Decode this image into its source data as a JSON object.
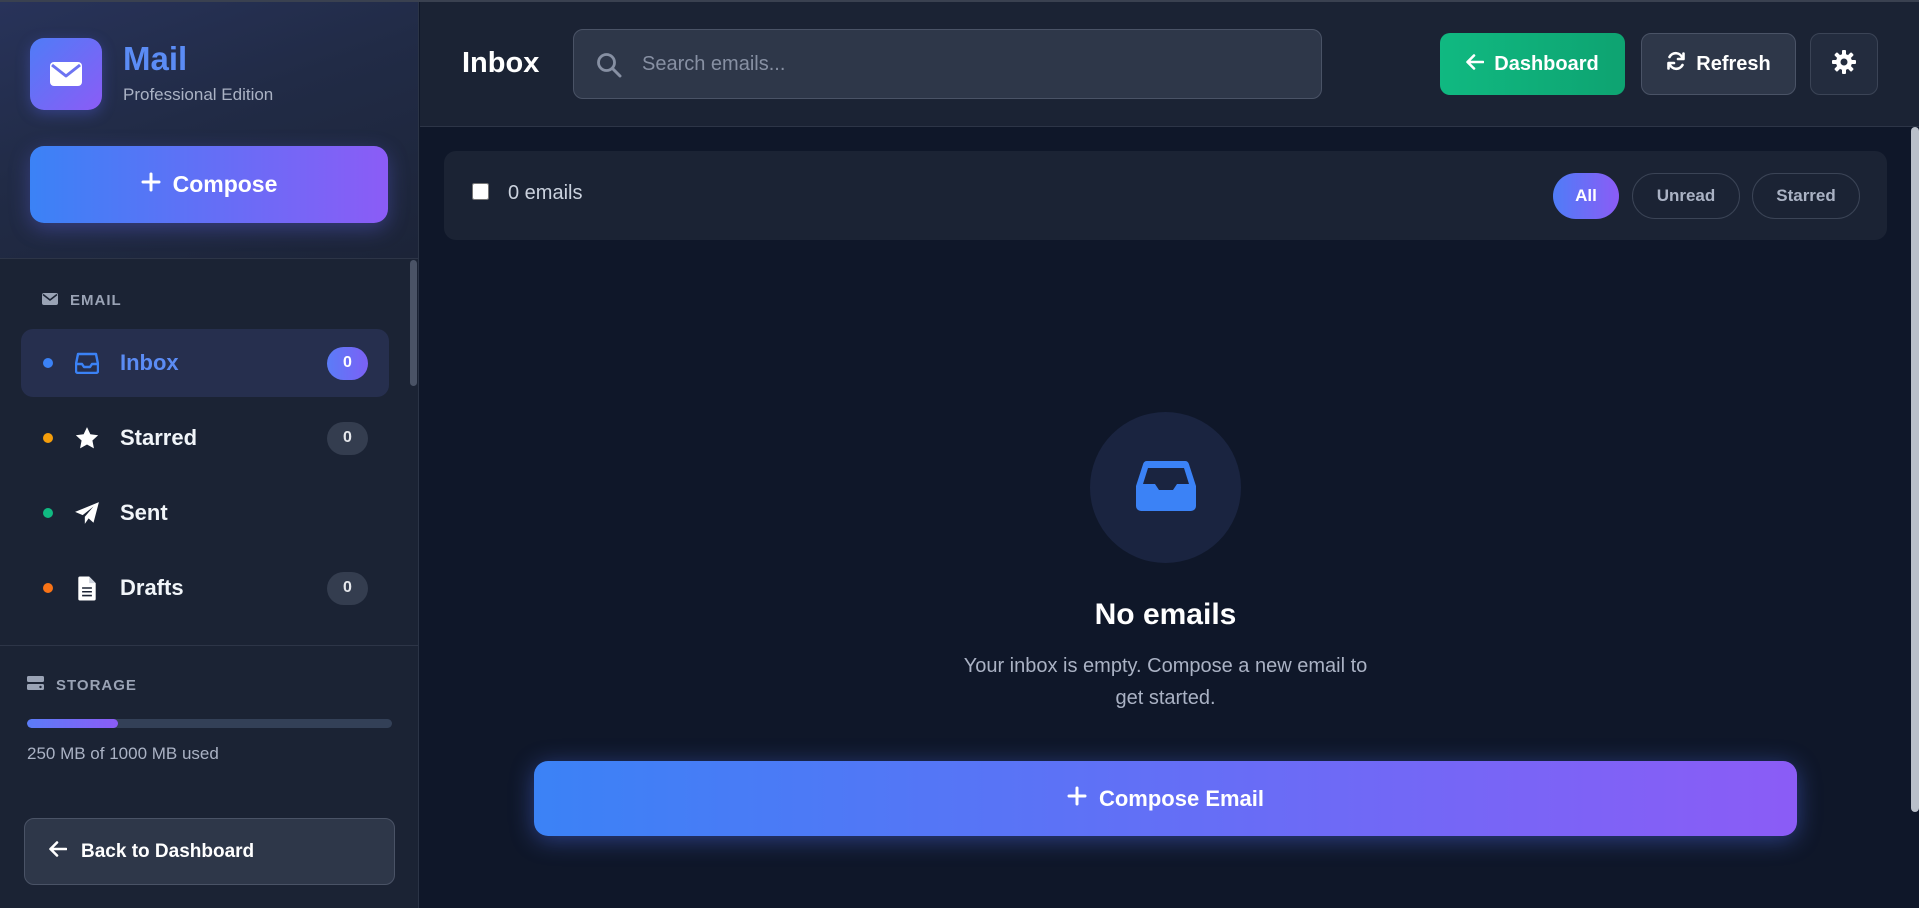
{
  "app": {
    "title": "Mail",
    "subtitle": "Professional Edition",
    "compose_label": "Compose"
  },
  "sidebar": {
    "email_section_label": "EMAIL",
    "items": [
      {
        "label": "Inbox",
        "badge": "0",
        "dot_color": "#3b82f6",
        "icon": "inbox-icon",
        "active": true
      },
      {
        "label": "Starred",
        "badge": "0",
        "dot_color": "#f59e0b",
        "icon": "star-icon",
        "active": false
      },
      {
        "label": "Sent",
        "badge": "",
        "dot_color": "#10b981",
        "icon": "paper-plane-icon",
        "active": false
      },
      {
        "label": "Drafts",
        "badge": "0",
        "dot_color": "#f97316",
        "icon": "document-icon",
        "active": false
      }
    ],
    "storage": {
      "label": "STORAGE",
      "used_mb": 250,
      "total_mb": 1000,
      "text": "250 MB of 1000 MB used"
    },
    "back_label": "Back to Dashboard"
  },
  "header": {
    "title": "Inbox",
    "search_placeholder": "Search emails...",
    "dashboard_label": "Dashboard",
    "refresh_label": "Refresh"
  },
  "toolbar": {
    "count_text": "0 emails",
    "filters": [
      {
        "label": "All",
        "active": true
      },
      {
        "label": "Unread",
        "active": false
      },
      {
        "label": "Starred",
        "active": false
      }
    ]
  },
  "empty_state": {
    "title": "No emails",
    "text": "Your inbox is empty. Compose a new email to get started.",
    "button_label": "Compose Email"
  },
  "colors": {
    "accent_blue": "#3b82f6",
    "accent_purple": "#8b5cf6",
    "success_green": "#10b981",
    "background": "#0f1729",
    "panel": "#1b2334"
  }
}
